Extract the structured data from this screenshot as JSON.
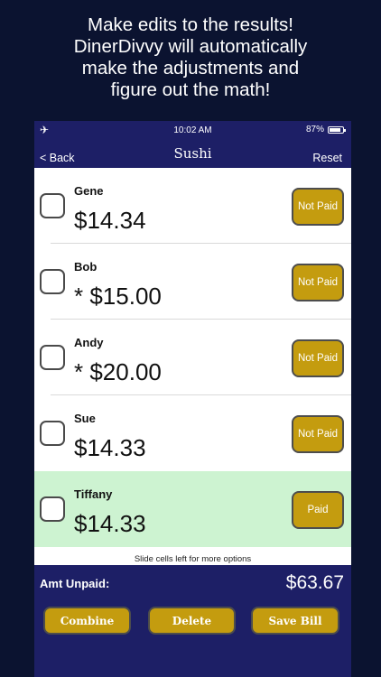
{
  "promo": {
    "lines": [
      "Make edits to the results!",
      "DinerDivvy will automatically",
      "make the adjustments and",
      "figure out the math!"
    ]
  },
  "status_bar": {
    "time": "10:02 AM",
    "battery": "87%",
    "battery_level": 0.87,
    "airplane_icon": "airplane-icon"
  },
  "nav": {
    "back_label": "< Back",
    "title": "Sushi",
    "reset_label": "Reset"
  },
  "diners": [
    {
      "name": "Gene",
      "amount": "$14.34",
      "status": "Not Paid",
      "checked": false
    },
    {
      "name": "Bob",
      "amount": "* $15.00",
      "status": "Not Paid",
      "checked": false
    },
    {
      "name": "Andy",
      "amount": "* $20.00",
      "status": "Not Paid",
      "checked": false
    },
    {
      "name": "Sue",
      "amount": "$14.33",
      "status": "Not Paid",
      "checked": false
    },
    {
      "name": "Tiffany",
      "amount": "$14.33",
      "status": "Paid",
      "checked": false
    }
  ],
  "hint": "Slide cells left for more options",
  "footer": {
    "unpaid_label": "Amt Unpaid:",
    "unpaid_total": "$63.67",
    "combine_label": "Combine",
    "delete_label": "Delete",
    "save_label": "Save Bill"
  },
  "colors": {
    "background": "#0b1330",
    "navy": "#1d1f66",
    "gold": "#c49c0f",
    "paid_row": "#cdf3d1"
  }
}
